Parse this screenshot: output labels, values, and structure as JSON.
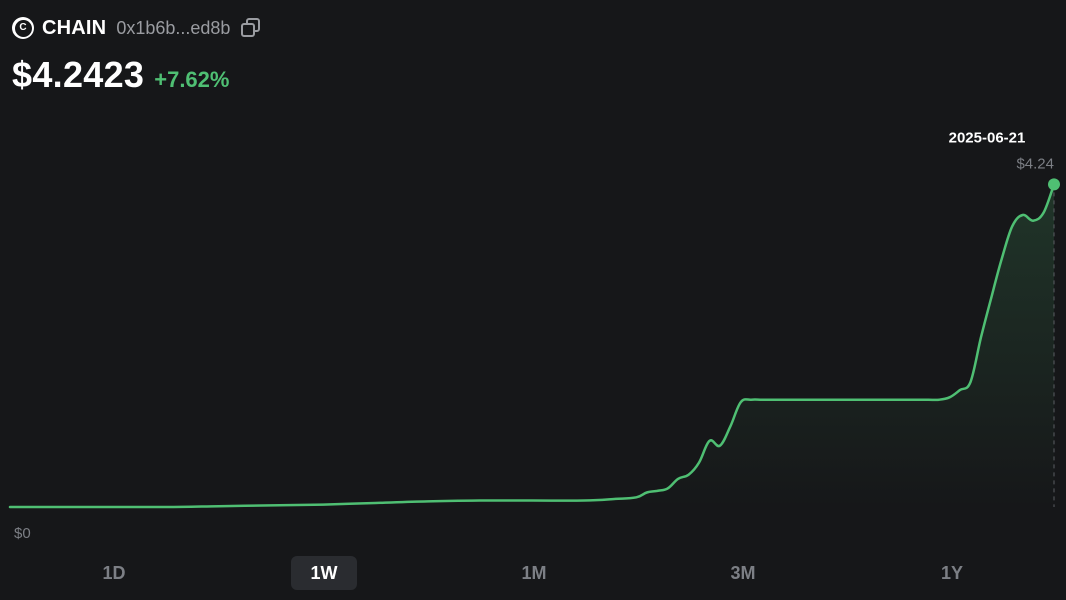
{
  "token": {
    "icon_letter": "C",
    "symbol": "CHAIN",
    "address": "0x1b6b...ed8b",
    "price": "$4.2423",
    "change": "+7.62%"
  },
  "colors": {
    "background": "#161719",
    "line": "#4fbf73",
    "muted": "#7c7f85"
  },
  "timeframes": [
    {
      "label": "1D",
      "active": false
    },
    {
      "label": "1W",
      "active": true
    },
    {
      "label": "1M",
      "active": false
    },
    {
      "label": "3M",
      "active": false
    },
    {
      "label": "1Y",
      "active": false
    }
  ],
  "chart_data": {
    "type": "area",
    "ylim": [
      0,
      4.24
    ],
    "y_min_label": "$0",
    "hover": {
      "date": "2025-06-21",
      "value_label": "$4.24"
    },
    "x": [
      0,
      5,
      10,
      15,
      20,
      25,
      30,
      35,
      40,
      45,
      50,
      55,
      58,
      60,
      61,
      62,
      63,
      64,
      65,
      66,
      67,
      68,
      69,
      70,
      71,
      72,
      73,
      74,
      76,
      78,
      80,
      82,
      84,
      86,
      87,
      88,
      89,
      90,
      91,
      92,
      93,
      94,
      95,
      96,
      97,
      98,
      99,
      100
    ],
    "values": [
      0.0,
      0.0,
      0.0,
      0.0,
      0.01,
      0.02,
      0.03,
      0.05,
      0.07,
      0.08,
      0.08,
      0.08,
      0.1,
      0.12,
      0.18,
      0.2,
      0.23,
      0.35,
      0.4,
      0.55,
      0.82,
      0.76,
      1.0,
      1.3,
      1.33,
      1.33,
      1.33,
      1.33,
      1.33,
      1.33,
      1.33,
      1.33,
      1.33,
      1.33,
      1.33,
      1.33,
      1.33,
      1.36,
      1.45,
      1.55,
      2.1,
      2.6,
      3.08,
      3.48,
      3.62,
      3.55,
      3.65,
      4.0
    ]
  }
}
